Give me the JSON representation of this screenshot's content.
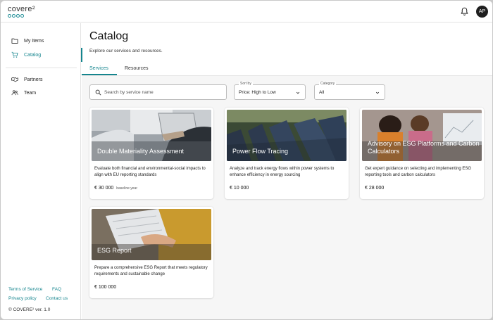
{
  "app": {
    "logo": "covere²",
    "avatar_initials": "AP"
  },
  "sidebar": {
    "items": [
      {
        "label": "My Items",
        "icon": "folder-icon"
      },
      {
        "label": "Catalog",
        "icon": "cart-icon",
        "active": true
      },
      {
        "label": "Partners",
        "icon": "handshake-icon"
      },
      {
        "label": "Team",
        "icon": "team-icon"
      }
    ],
    "footer": {
      "terms": "Terms of Service",
      "faq": "FAQ",
      "privacy": "Privacy policy",
      "contact": "Contact us",
      "copyright": "© COVERE² ver. 1.0"
    }
  },
  "page": {
    "title": "Catalog",
    "subtitle": "Explore our services and resources.",
    "tabs": [
      {
        "label": "Services",
        "active": true
      },
      {
        "label": "Resources",
        "active": false
      }
    ]
  },
  "filters": {
    "search_placeholder": "Search by service name",
    "sort": {
      "label": "Sort by",
      "value": "Price: High to Low"
    },
    "category": {
      "label": "Category",
      "value": "All"
    }
  },
  "cards": [
    {
      "title": "Double Materiality Assessment",
      "description": "Evaluate both financial and environmental-social impacts to align with EU reporting standards",
      "price": "€ 30 000",
      "price_note": "baseline year"
    },
    {
      "title": "Power Flow Tracing",
      "description": "Analyze and track energy flows within power systems to enhance efficiency in energy sourcing",
      "price": "€ 10 000",
      "price_note": ""
    },
    {
      "title": "Advisory on ESG Platforms and Carbon Calculators",
      "description": "Get expert guidance on selecting and implementing ESG reporting tools and carbon calculators",
      "price": "€ 28 000",
      "price_note": ""
    },
    {
      "title": "ESG Report",
      "description": "Prepare a comprehensive ESG Report that meets regulatory requirements and sustainable change",
      "price": "€ 100 000",
      "price_note": ""
    }
  ],
  "colors": {
    "accent": "#15858e",
    "text": "#1c1c1c",
    "background": "#f6f6f6"
  }
}
